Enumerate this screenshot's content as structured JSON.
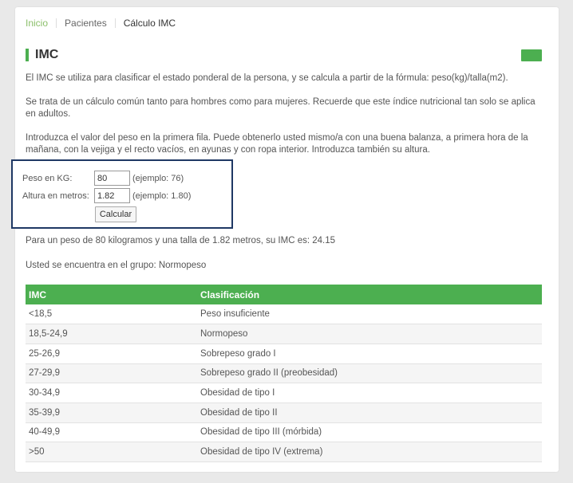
{
  "breadcrumb": {
    "home": "Inicio",
    "patients": "Pacientes",
    "current": "Cálculo IMC"
  },
  "page": {
    "title": "IMC"
  },
  "description": {
    "p1": "El IMC se utiliza para clasificar el estado ponderal de la persona, y se calcula a partir de la fórmula: peso(kg)/talla(m2).",
    "p2": "Se trata de un cálculo común tanto para hombres como para mujeres. Recuerde que este índice nutricional tan solo se aplica en adultos.",
    "p3": "Introduzca el valor del peso en la primera fila. Puede obtenerlo usted mismo/a con una buena balanza, a primera hora de la mañana, con la vejiga y el recto vacíos, en ayunas y con ropa interior. Introduzca también su altura."
  },
  "form": {
    "weight_label": "Peso en KG:",
    "weight_value": "80",
    "weight_hint": "(ejemplo: 76)",
    "height_label": "Altura en metros:",
    "height_value": "1.82",
    "height_hint": "(ejemplo: 1.80)",
    "calc_label": "Calcular"
  },
  "result": {
    "line1": "Para un peso de 80 kilogramos y una talla de 1.82 metros, su IMC es: 24.15",
    "line2": "Usted se encuentra en el grupo: Normopeso"
  },
  "table": {
    "headers": [
      "IMC",
      "Clasificación"
    ],
    "rows": [
      [
        "<18,5",
        "Peso insuficiente"
      ],
      [
        "18,5-24,9",
        "Normopeso"
      ],
      [
        "25-26,9",
        "Sobrepeso grado I"
      ],
      [
        "27-29,9",
        "Sobrepeso grado II (preobesidad)"
      ],
      [
        "30-34,9",
        "Obesidad de tipo I"
      ],
      [
        "35-39,9",
        "Obesidad de tipo II"
      ],
      [
        "40-49,9",
        "Obesidad de tipo III (mórbida)"
      ],
      [
        ">50",
        "Obesidad de tipo IV (extrema)"
      ]
    ]
  },
  "colors": {
    "accent": "#4caf50",
    "link": "#8bbf6a",
    "highlight_border": "#1f3864"
  }
}
